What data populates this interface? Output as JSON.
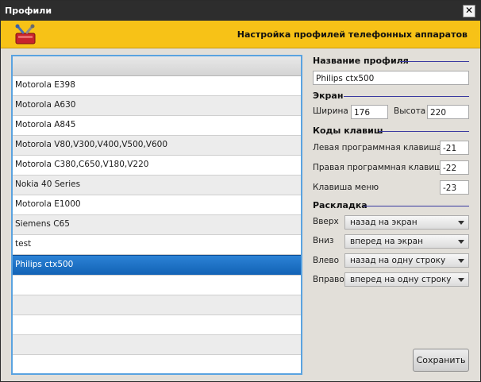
{
  "window": {
    "title": "Профили",
    "close_glyph": "✕"
  },
  "banner": {
    "text": "Настройка профилей телефонных аппаратов",
    "icon": "profile-tools-icon"
  },
  "profiles": {
    "items": [
      "Motorola E398",
      "Motorola A630",
      "Motorola A845",
      "Motorola V80,V300,V400,V500,V600",
      "Motorola C380,C650,V180,V220",
      "Nokia 40 Series",
      "Motorola E1000",
      "Siemens C65",
      "test",
      "Philips ctx500",
      "",
      "",
      "",
      "",
      ""
    ],
    "selected": "Philips ctx500"
  },
  "profile_name": {
    "heading": "Название профиля",
    "value": "Philips ctx500"
  },
  "screen": {
    "heading": "Экран",
    "width_label": "Ширина",
    "width_value": "176",
    "height_label": "Высота",
    "height_value": "220"
  },
  "keys": {
    "heading": "Коды клавиш",
    "left_soft_label": "Левая программная клавиша",
    "left_soft_value": "-21",
    "right_soft_label": "Правая программная клавиша",
    "right_soft_value": "-22",
    "menu_label": "Клавиша меню",
    "menu_value": "-23"
  },
  "layout": {
    "heading": "Раскладка",
    "up_label": "Вверх",
    "up_value": "назад на экран",
    "down_label": "Вниз",
    "down_value": "вперед на экран",
    "left_label": "Влево",
    "left_value": "назад на одну строку",
    "right_label": "Вправо",
    "right_value": "вперед на одну строку"
  },
  "actions": {
    "save_label": "Сохранить"
  },
  "colors": {
    "title_bar": "#2d2d2d",
    "banner": "#f7c217",
    "selection": "#1b6fc4",
    "list_border": "#5aa3e0",
    "section_line": "#3a3aa0"
  }
}
